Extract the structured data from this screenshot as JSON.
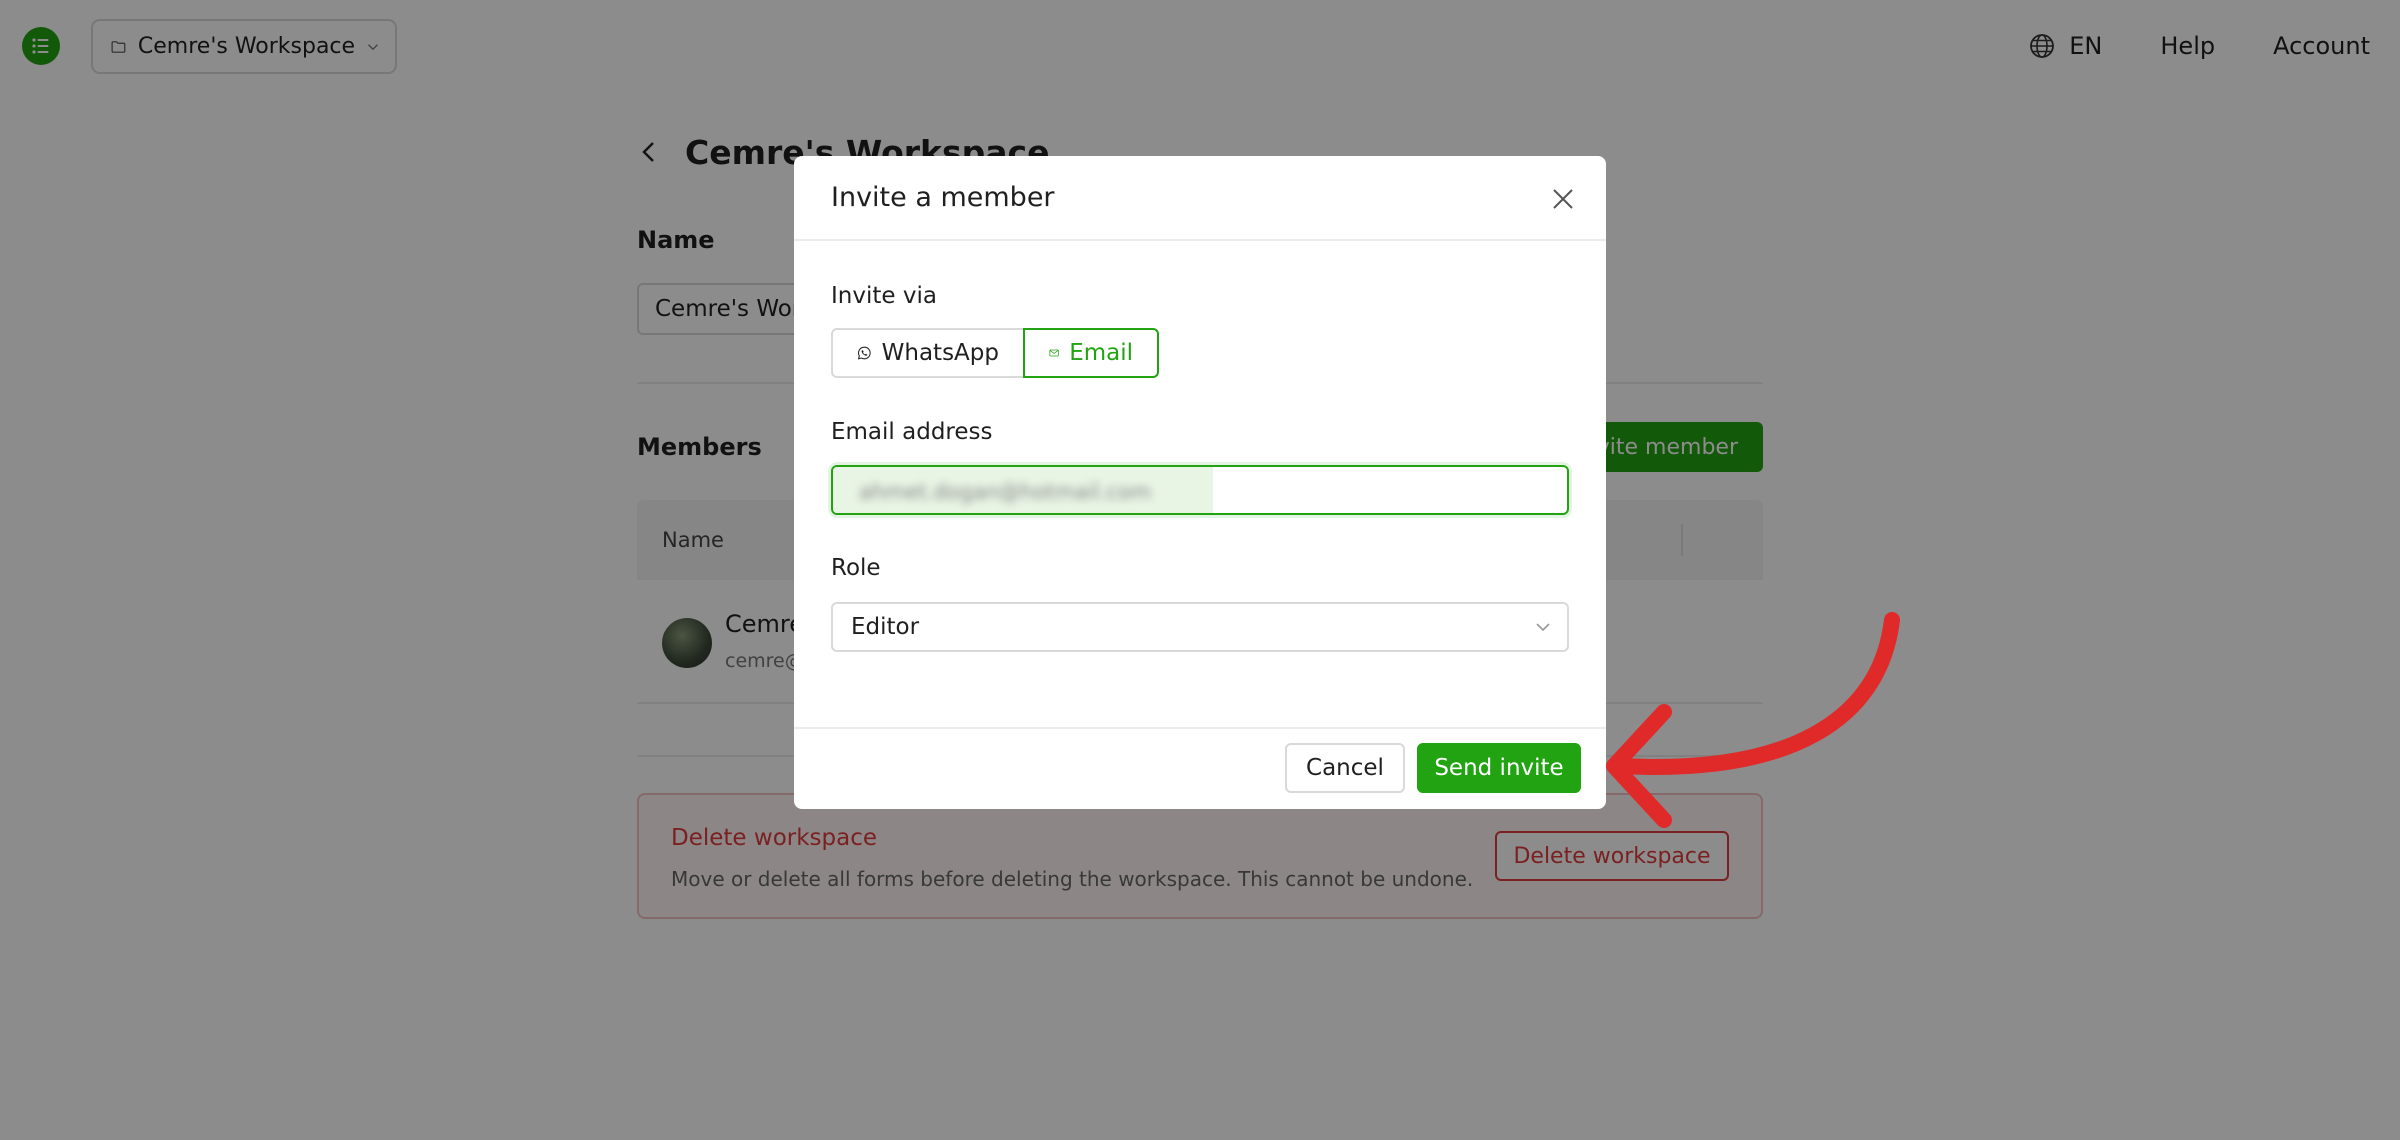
{
  "topbar": {
    "workspace_switcher": "Cemre's Workspace",
    "language": "EN",
    "help": "Help",
    "account": "Account"
  },
  "page": {
    "title": "Cemre's Workspace",
    "name_label": "Name",
    "name_value": "Cemre's Wor",
    "members_label": "Members",
    "invite_button": "vite member",
    "table": {
      "columns": [
        "Name"
      ],
      "rows": [
        {
          "name": "Cemre",
          "email": "cemre@"
        }
      ]
    },
    "danger": {
      "title": "Delete workspace",
      "text": "Move or delete all forms before deleting the workspace. This cannot be undone.",
      "button": "Delete workspace"
    }
  },
  "modal": {
    "title": "Invite a member",
    "invite_via_label": "Invite via",
    "options": [
      {
        "label": "WhatsApp",
        "icon": "whatsapp-icon",
        "active": false
      },
      {
        "label": "Email",
        "icon": "mail-icon",
        "active": true
      }
    ],
    "email_label": "Email address",
    "email_value": "ahmet.dogan@hotmail.com",
    "role_label": "Role",
    "role_value": "Editor",
    "cancel": "Cancel",
    "send": "Send invite"
  },
  "colors": {
    "accent": "#22a312",
    "danger": "#e03b3b",
    "annotation": "#e02a2a"
  }
}
